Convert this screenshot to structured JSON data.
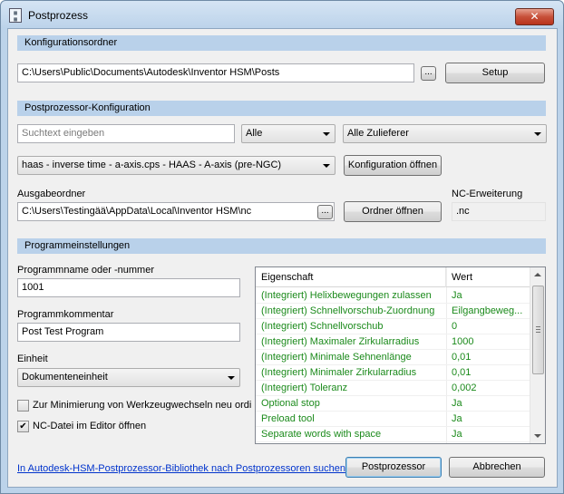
{
  "window": {
    "title": "Postprozess",
    "close_label": "✕"
  },
  "sections": {
    "config_folder": "Konfigurationsordner",
    "post_config": "Postprozessor-Konfiguration",
    "program_settings": "Programmeinstellungen"
  },
  "config_folder": {
    "path": "C:\\Users\\Public\\Documents\\Autodesk\\Inventor HSM\\Posts",
    "browse_label": "...",
    "setup_label": "Setup"
  },
  "post_config": {
    "search_placeholder": "Suchtext eingeben",
    "filter_value": "Alle",
    "vendor_value": "Alle Zulieferer",
    "post_value": "haas - inverse time - a-axis.cps - HAAS - A-axis (pre-NGC)",
    "open_config_label": "Konfiguration öffnen"
  },
  "output": {
    "folder_label": "Ausgabeordner",
    "folder_path": "C:\\Users\\Testingää\\AppData\\Local\\Inventor HSM\\nc",
    "browse_label": "...",
    "open_folder_label": "Ordner öffnen",
    "ext_label": "NC-Erweiterung",
    "ext_value": ".nc"
  },
  "program": {
    "name_label": "Programmname oder -nummer",
    "name_value": "1001",
    "comment_label": "Programmkommentar",
    "comment_value": "Post Test Program",
    "unit_label": "Einheit",
    "unit_value": "Dokumenteneinheit",
    "minimize_label": "Zur Minimierung von Werkzeugwechseln neu ordi",
    "minimize_checked": false,
    "open_editor_label": "NC-Datei im Editor öffnen",
    "open_editor_checked": true
  },
  "properties": {
    "col_property": "Eigenschaft",
    "col_value": "Wert",
    "rows": [
      {
        "name": "(Integriert) Helixbewegungen zulassen",
        "value": "Ja"
      },
      {
        "name": "(Integriert) Schnellvorschub-Zuordnung",
        "value": "Eilgangbeweg..."
      },
      {
        "name": "(Integriert) Schnellvorschub",
        "value": "0"
      },
      {
        "name": "(Integriert) Maximaler Zirkularradius",
        "value": "1000"
      },
      {
        "name": "(Integriert) Minimale Sehnenlänge",
        "value": "0,01"
      },
      {
        "name": "(Integriert) Minimaler Zirkularradius",
        "value": "0,01"
      },
      {
        "name": "(Integriert) Toleranz",
        "value": "0,002"
      },
      {
        "name": "Optional stop",
        "value": "Ja"
      },
      {
        "name": "Preload tool",
        "value": "Ja"
      },
      {
        "name": "Separate words with space",
        "value": "Ja"
      }
    ]
  },
  "footer": {
    "library_link": "In Autodesk-HSM-Postprozessor-Bibliothek nach Postprozessoren suchen",
    "post_button": "Postprozessor",
    "cancel_button": "Abbrechen"
  },
  "colors": {
    "section_header": "#b9d1ea",
    "property_text": "#1b8a1b",
    "link": "#0033cc"
  }
}
